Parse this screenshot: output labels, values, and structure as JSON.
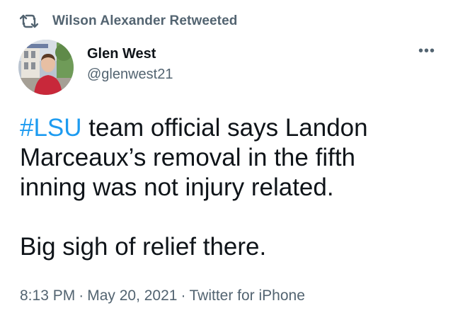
{
  "retweet": {
    "icon": "retweet-icon",
    "text": "Wilson Alexander Retweeted"
  },
  "author": {
    "display_name": "Glen West",
    "handle": "@glenwest21",
    "avatar": "avatar-photo"
  },
  "more_menu": {
    "icon": "more-dots-icon",
    "glyph": "•••"
  },
  "tweet": {
    "hashtag": "#LSU",
    "line1_rest": " team official says Landon",
    "line2": "Marceaux’s removal in the fifth",
    "line3": "inning was not injury related.",
    "line4": "Big sigh of relief there."
  },
  "meta": {
    "time": "8:13 PM",
    "separator": "·",
    "date": "May 20, 2021",
    "source": "Twitter for iPhone"
  },
  "colors": {
    "link": "#1d9bf0",
    "secondary_text": "#536471",
    "primary_text": "#0f1419",
    "background": "#ffffff"
  }
}
